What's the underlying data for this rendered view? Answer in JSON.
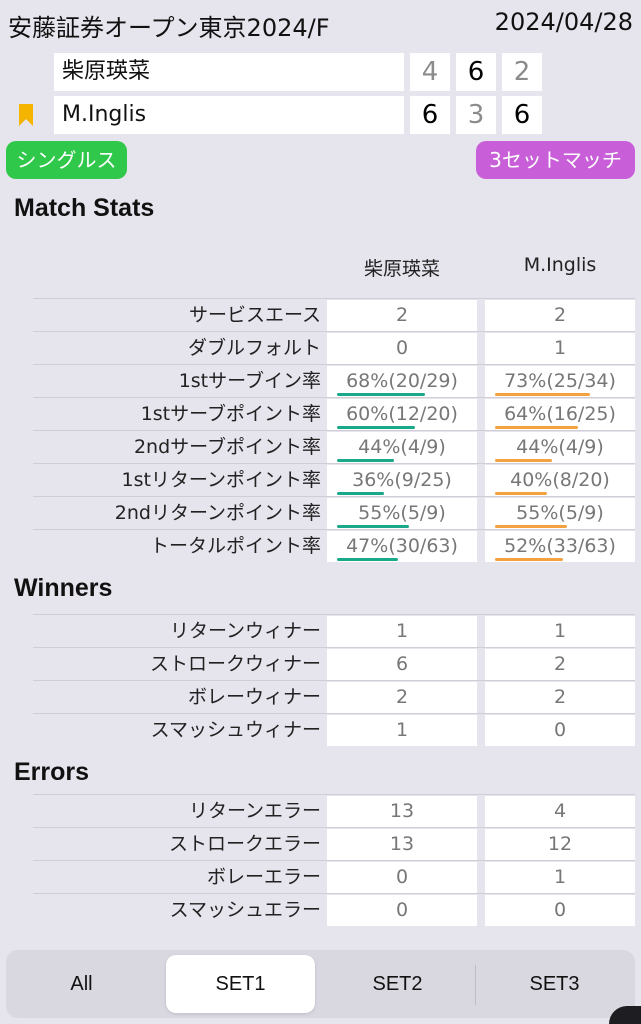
{
  "header": {
    "tournament": "安藤証券オープン東京2024/F",
    "date": "2024/04/28"
  },
  "players": [
    {
      "name": "柴原瑛菜",
      "sets": [
        "4",
        "6",
        "2"
      ],
      "set_win": [
        false,
        true,
        false
      ]
    },
    {
      "name": "M.Inglis",
      "sets": [
        "6",
        "3",
        "6"
      ],
      "set_win": [
        true,
        false,
        true
      ]
    }
  ],
  "tags": {
    "match_type": "シングルス",
    "format": "3セットマッチ"
  },
  "colors": {
    "singles": "#30c84b",
    "format": "#c85fd8",
    "p1_bar": "#19a98a",
    "p2_bar": "#f3a23f"
  },
  "icons": {
    "winner_marker": "bookmark-icon"
  },
  "match_stats": {
    "title": "Match Stats",
    "col_p1": "柴原瑛菜",
    "col_p2": "M.Inglis",
    "rows": [
      {
        "label": "サービスエース",
        "p1": "2",
        "p2": "2"
      },
      {
        "label": "ダブルフォルト",
        "p1": "0",
        "p2": "1"
      },
      {
        "label": "1stサーブイン率",
        "p1": "68%(20/29)",
        "p2": "73%(25/34)",
        "p1_pct": 68,
        "p2_pct": 73
      },
      {
        "label": "1stサーブポイント率",
        "p1": "60%(12/20)",
        "p2": "64%(16/25)",
        "p1_pct": 60,
        "p2_pct": 64
      },
      {
        "label": "2ndサーブポイント率",
        "p1": "44%(4/9)",
        "p2": "44%(4/9)",
        "p1_pct": 44,
        "p2_pct": 44
      },
      {
        "label": "1stリターンポイント率",
        "p1": "36%(9/25)",
        "p2": "40%(8/20)",
        "p1_pct": 36,
        "p2_pct": 40
      },
      {
        "label": "2ndリターンポイント率",
        "p1": "55%(5/9)",
        "p2": "55%(5/9)",
        "p1_pct": 55,
        "p2_pct": 55
      },
      {
        "label": "トータルポイント率",
        "p1": "47%(30/63)",
        "p2": "52%(33/63)",
        "p1_pct": 47,
        "p2_pct": 52
      }
    ]
  },
  "winners": {
    "title": "Winners",
    "rows": [
      {
        "label": "リターンウィナー",
        "p1": "1",
        "p2": "1"
      },
      {
        "label": "ストロークウィナー",
        "p1": "6",
        "p2": "2"
      },
      {
        "label": "ボレーウィナー",
        "p1": "2",
        "p2": "2"
      },
      {
        "label": "スマッシュウィナー",
        "p1": "1",
        "p2": "0"
      }
    ]
  },
  "errors": {
    "title": "Errors",
    "rows": [
      {
        "label": "リターンエラー",
        "p1": "13",
        "p2": "4"
      },
      {
        "label": "ストロークエラー",
        "p1": "13",
        "p2": "12"
      },
      {
        "label": "ボレーエラー",
        "p1": "0",
        "p2": "1"
      },
      {
        "label": "スマッシュエラー",
        "p1": "0",
        "p2": "0"
      }
    ]
  },
  "tabs": {
    "items": [
      "All",
      "SET1",
      "SET2",
      "SET3"
    ],
    "active": "SET1"
  }
}
